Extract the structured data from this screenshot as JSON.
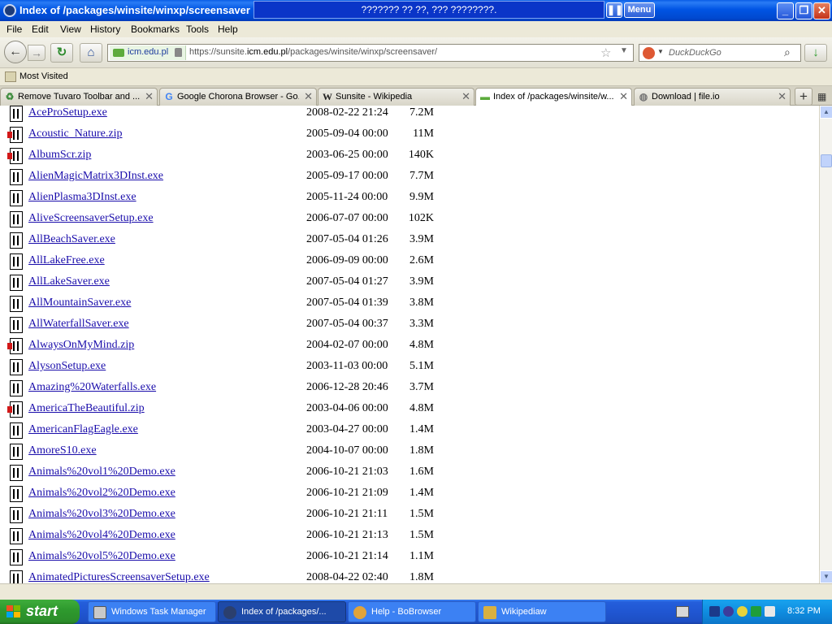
{
  "window": {
    "title": "Index of /packages/winsite/winxp/screensaver",
    "remote_bar_text": "??????? ?? ??, ??? ????????.",
    "pause_symbol": "❚❚",
    "menu_btn_label": "Menu",
    "minimize_symbol": "_",
    "restore_symbol": "❐",
    "close_symbol": "✕"
  },
  "menubar": {
    "items": [
      "File",
      "Edit",
      "View",
      "History",
      "Bookmarks",
      "Tools",
      "Help"
    ]
  },
  "navbar": {
    "back_symbol": "←",
    "forward_symbol": "→",
    "reload_symbol": "↻",
    "home_symbol": "⌂",
    "identity": "icm.edu.pl",
    "url_prefix": "https://sunsite.",
    "url_domain": "icm.edu.pl",
    "url_path": "/packages/winsite/winxp/screensaver/",
    "star_symbol": "☆",
    "dropdown_symbol": "▼",
    "search_engine_dropdown": "▼",
    "search_placeholder": "DuckDuckGo",
    "search_symbol": "⌕",
    "download_symbol": "↓"
  },
  "bookmarks": {
    "label": "Most Visited"
  },
  "tabs": [
    {
      "label": "Remove Tuvaro Toolbar and ...",
      "icon": "tuvaro-icon",
      "icon_char": "♻",
      "icon_color": "#3d8c3d",
      "active": false
    },
    {
      "label": "Google Chorona Browser - Go...",
      "icon": "google-icon",
      "icon_char": "G",
      "icon_color": "#4285f4",
      "active": false
    },
    {
      "label": "Sunsite - Wikipedia",
      "icon": "wikipedia-icon",
      "icon_char": "W",
      "icon_color": "#222222",
      "active": false
    },
    {
      "label": "Index of /packages/winsite/w...",
      "icon": "sunsite-icon",
      "icon_char": "▬",
      "icon_color": "#5cab3c",
      "active": true
    },
    {
      "label": "Download | file.io",
      "icon": "globe-icon",
      "icon_char": "◍",
      "icon_color": "#777777",
      "active": false
    }
  ],
  "tab_close_symbol": "✕",
  "new_tab_symbol": "+",
  "tab_list_symbol": "▦",
  "files": [
    {
      "name": "AceProSetup.exe",
      "date": "2008-02-22 21:24",
      "size": "7.2M",
      "type": "exe"
    },
    {
      "name": "Acoustic_Nature.zip",
      "date": "2005-09-04 00:00",
      "size": "11M",
      "type": "zip"
    },
    {
      "name": "AlbumScr.zip",
      "date": "2003-06-25 00:00",
      "size": "140K",
      "type": "zip"
    },
    {
      "name": "AlienMagicMatrix3DInst.exe",
      "date": "2005-09-17 00:00",
      "size": "7.7M",
      "type": "exe"
    },
    {
      "name": "AlienPlasma3DInst.exe",
      "date": "2005-11-24 00:00",
      "size": "9.9M",
      "type": "exe"
    },
    {
      "name": "AliveScreensaverSetup.exe",
      "date": "2006-07-07 00:00",
      "size": "102K",
      "type": "exe"
    },
    {
      "name": "AllBeachSaver.exe",
      "date": "2007-05-04 01:26",
      "size": "3.9M",
      "type": "exe"
    },
    {
      "name": "AllLakeFree.exe",
      "date": "2006-09-09 00:00",
      "size": "2.6M",
      "type": "exe"
    },
    {
      "name": "AllLakeSaver.exe",
      "date": "2007-05-04 01:27",
      "size": "3.9M",
      "type": "exe"
    },
    {
      "name": "AllMountainSaver.exe",
      "date": "2007-05-04 01:39",
      "size": "3.8M",
      "type": "exe"
    },
    {
      "name": "AllWaterfallSaver.exe",
      "date": "2007-05-04 00:37",
      "size": "3.3M",
      "type": "exe"
    },
    {
      "name": "AlwaysOnMyMind.zip",
      "date": "2004-02-07 00:00",
      "size": "4.8M",
      "type": "zip"
    },
    {
      "name": "AlysonSetup.exe",
      "date": "2003-11-03 00:00",
      "size": "5.1M",
      "type": "exe"
    },
    {
      "name": "Amazing%20Waterfalls.exe",
      "date": "2006-12-28 20:46",
      "size": "3.7M",
      "type": "exe"
    },
    {
      "name": "AmericaTheBeautiful.zip",
      "date": "2003-04-06 00:00",
      "size": "4.8M",
      "type": "zip"
    },
    {
      "name": "AmericanFlagEagle.exe",
      "date": "2003-04-27 00:00",
      "size": "1.4M",
      "type": "exe"
    },
    {
      "name": "AmoreS10.exe",
      "date": "2004-10-07 00:00",
      "size": "1.8M",
      "type": "exe"
    },
    {
      "name": "Animals%20vol1%20Demo.exe",
      "date": "2006-10-21 21:03",
      "size": "1.6M",
      "type": "exe"
    },
    {
      "name": "Animals%20vol2%20Demo.exe",
      "date": "2006-10-21 21:09",
      "size": "1.4M",
      "type": "exe"
    },
    {
      "name": "Animals%20vol3%20Demo.exe",
      "date": "2006-10-21 21:11",
      "size": "1.5M",
      "type": "exe"
    },
    {
      "name": "Animals%20vol4%20Demo.exe",
      "date": "2006-10-21 21:13",
      "size": "1.5M",
      "type": "exe"
    },
    {
      "name": "Animals%20vol5%20Demo.exe",
      "date": "2006-10-21 21:14",
      "size": "1.1M",
      "type": "exe"
    },
    {
      "name": "AnimatedPicturesScreensaverSetup.exe",
      "date": "2008-04-22 02:40",
      "size": "1.8M",
      "type": "exe"
    }
  ],
  "scrollbar": {
    "up_symbol": "▲",
    "down_symbol": "▼"
  },
  "taskbar": {
    "start_label": "start",
    "tasks": [
      {
        "label": "Windows Task Manager",
        "icon": "task-manager-icon",
        "color": "#c9c9c9",
        "active": false
      },
      {
        "label": "Index of /packages/...",
        "icon": "firefox-icon",
        "color": "#2b3f6e",
        "active": true
      },
      {
        "label": "Help - BoBrowser",
        "icon": "chrome-icon",
        "color": "#e0a33b",
        "active": false
      },
      {
        "label": "Wikipediaw",
        "icon": "books-icon",
        "color": "#d9b040",
        "active": false
      }
    ],
    "clock": "8:32 PM"
  },
  "colors": {
    "link": "#1a0dab",
    "titlebar": "#0054e3",
    "start": "#2e9a2e"
  }
}
